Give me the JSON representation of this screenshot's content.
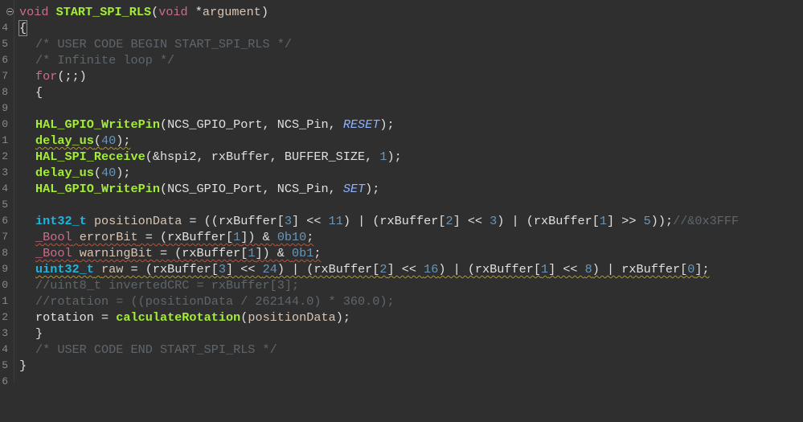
{
  "line_numbers": [
    "4",
    "5",
    "6",
    "7",
    "8",
    "9",
    "0",
    "1",
    "2",
    "3",
    "4",
    "5",
    "6",
    "7",
    "8",
    "9",
    "0",
    "1",
    "2",
    "3",
    "4",
    "5",
    "6"
  ],
  "code": {
    "l1_void": "void",
    "l1_name": "START_SPI_RLS",
    "l1_open": "(",
    "l1_void2": "void",
    "l1_star": " *",
    "l1_arg": "argument",
    "l1_close": ")",
    "l2_brace": "{",
    "l3_comment": "/* USER CODE BEGIN START_SPI_RLS */",
    "l4_comment": "/* Infinite loop */",
    "l5_for": "for",
    "l5_rest": "(;;)",
    "l6_brace": "{",
    "l8_fn": "HAL_GPIO_WritePin",
    "l8_args": "(NCS_GPIO_Port, NCS_Pin, ",
    "l8_const": "RESET",
    "l8_end": ");",
    "l9_fn": "delay_us",
    "l9_open": "(",
    "l9_num": "40",
    "l9_end": ");",
    "l10_fn": "HAL_SPI_Receive",
    "l10_args": "(&hspi2, rxBuffer, BUFFER_SIZE, ",
    "l10_num": "1",
    "l10_end": ");",
    "l11_fn": "delay_us",
    "l11_open": "(",
    "l11_num": "40",
    "l11_end": ");",
    "l12_fn": "HAL_GPIO_WritePin",
    "l12_args": "(NCS_GPIO_Port, NCS_Pin, ",
    "l12_const": "SET",
    "l12_end": ");",
    "l14_type": "int32_t",
    "l14_var": "positionData",
    "l14_a": " = ((rxBuffer[",
    "l14_n1": "3",
    "l14_b": "] << ",
    "l14_n2": "11",
    "l14_c": ") | (rxBuffer[",
    "l14_n3": "2",
    "l14_d": "] << ",
    "l14_n4": "3",
    "l14_e": ") | (rxBuffer[",
    "l14_n5": "1",
    "l14_f": "] >> ",
    "l14_n6": "5",
    "l14_g": "));",
    "l14_cm": "//&0x3FFF",
    "l15_type": "_Bool",
    "l15_var": "errorBit",
    "l15_a": " = (rxBuffer[",
    "l15_n1": "1",
    "l15_b": "]) & ",
    "l15_n2": "0b10",
    "l15_c": ";",
    "l16_type": "_Bool",
    "l16_var": "warningBit",
    "l16_a": " = (rxBuffer[",
    "l16_n1": "1",
    "l16_b": "]) & ",
    "l16_n2": "0b1",
    "l16_c": ";",
    "l17_type": "uint32_t",
    "l17_var": "raw",
    "l17_a": " = (rxBuffer[",
    "l17_n1": "3",
    "l17_b": "] << ",
    "l17_n2": "24",
    "l17_c": ") | (rxBuffer[",
    "l17_n3": "2",
    "l17_d": "] << ",
    "l17_n4": "16",
    "l17_e": ") | (rxBuffer[",
    "l17_n5": "1",
    "l17_f": "] << ",
    "l17_n6": "8",
    "l17_g": ") | rxBuffer[",
    "l17_n7": "0",
    "l17_h": "];",
    "l18_cm": "//uint8_t invertedCRC = rxBuffer[3];",
    "l19_cm": "//rotation = ((positionData / 262144.0) * 360.0);",
    "l20_var": "rotation",
    "l20_a": " = ",
    "l20_fn": "calculateRotation",
    "l20_b": "(",
    "l20_arg": "positionData",
    "l20_c": ");",
    "l21_brace": "}",
    "l22_comment": "/* USER CODE END START_SPI_RLS */",
    "l23_brace": "}"
  },
  "colors": {
    "background": "#2f2f2f",
    "keyword": "#cc6c8d",
    "function": "#a3ec37",
    "type": "#1eb4e0",
    "comment": "#5f666b",
    "number": "#6897bb"
  }
}
